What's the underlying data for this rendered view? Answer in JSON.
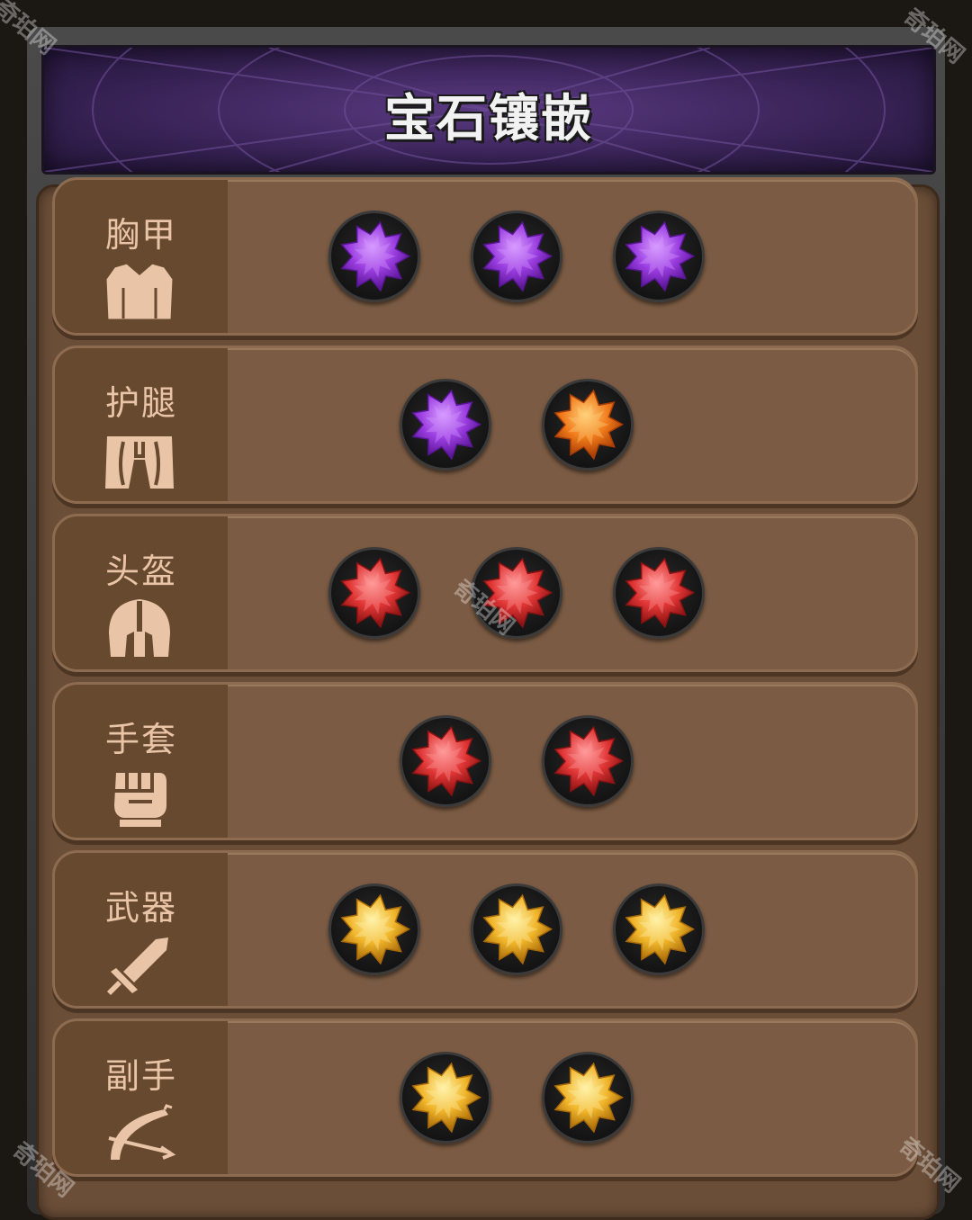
{
  "title": "宝石镶嵌",
  "watermark": "奇珀网",
  "gem_colors": {
    "purple": {
      "light": "#d89bff",
      "mid": "#9a3de0",
      "dark": "#5a1596"
    },
    "orange": {
      "light": "#ffd07a",
      "mid": "#f07a1a",
      "dark": "#a83c05"
    },
    "red": {
      "light": "#ff9a9a",
      "mid": "#e03535",
      "dark": "#8a1212"
    },
    "gold": {
      "light": "#fff2a8",
      "mid": "#f0b52a",
      "dark": "#a86a08"
    }
  },
  "slots": [
    {
      "label": "胸甲",
      "icon": "chest-armor-icon",
      "gems": [
        "purple",
        "purple",
        "purple"
      ]
    },
    {
      "label": "护腿",
      "icon": "leg-armor-icon",
      "gems": [
        "purple",
        "orange"
      ]
    },
    {
      "label": "头盔",
      "icon": "helmet-icon",
      "gems": [
        "red",
        "red",
        "red"
      ]
    },
    {
      "label": "手套",
      "icon": "fist-gauntlet-icon",
      "gems": [
        "red",
        "red"
      ]
    },
    {
      "label": "武器",
      "icon": "sword-icon",
      "gems": [
        "gold",
        "gold",
        "gold"
      ]
    },
    {
      "label": "副手",
      "icon": "bow-icon",
      "gems": [
        "gold",
        "gold"
      ]
    }
  ]
}
